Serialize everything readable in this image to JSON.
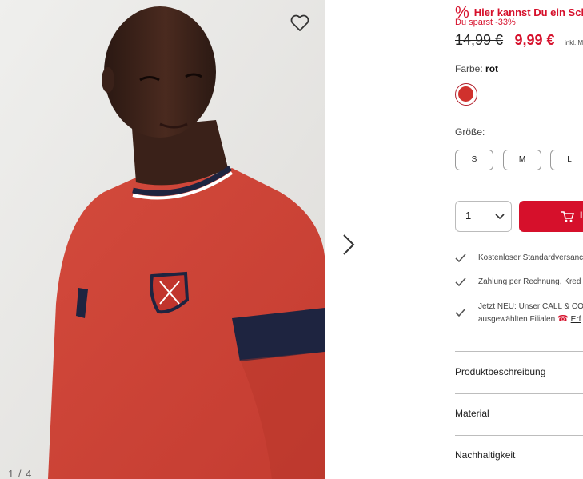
{
  "gallery": {
    "counter": "1 / 4",
    "wishlist_icon": "heart-outline-icon",
    "next_icon": "chevron-right-icon"
  },
  "promo": {
    "icon": "%",
    "title": "Hier kannst Du ein Schnä",
    "savings": "Du sparst -33%"
  },
  "price": {
    "old": "14,99 €",
    "new": "9,99 €",
    "tax_note": "inkl. M"
  },
  "color": {
    "label": "Farbe:",
    "value": "rot",
    "swatch_hex": "#d0312d"
  },
  "size": {
    "label": "Größe:",
    "options": [
      "S",
      "M",
      "L"
    ]
  },
  "quantity": {
    "value": "1"
  },
  "cart": {
    "label": "I",
    "accent": "#d6102b"
  },
  "usps": [
    {
      "text": "Kostenloser Standardversanc"
    },
    {
      "text": "Zahlung per Rechnung, Kred"
    },
    {
      "line1": "Jetzt NEU: Unser CALL & CO",
      "line2": "ausgewählten Filialen",
      "link": "Erf"
    }
  ],
  "accordion": [
    {
      "label": "Produktbeschreibung"
    },
    {
      "label": "Material"
    },
    {
      "label": "Nachhaltigkeit"
    }
  ]
}
